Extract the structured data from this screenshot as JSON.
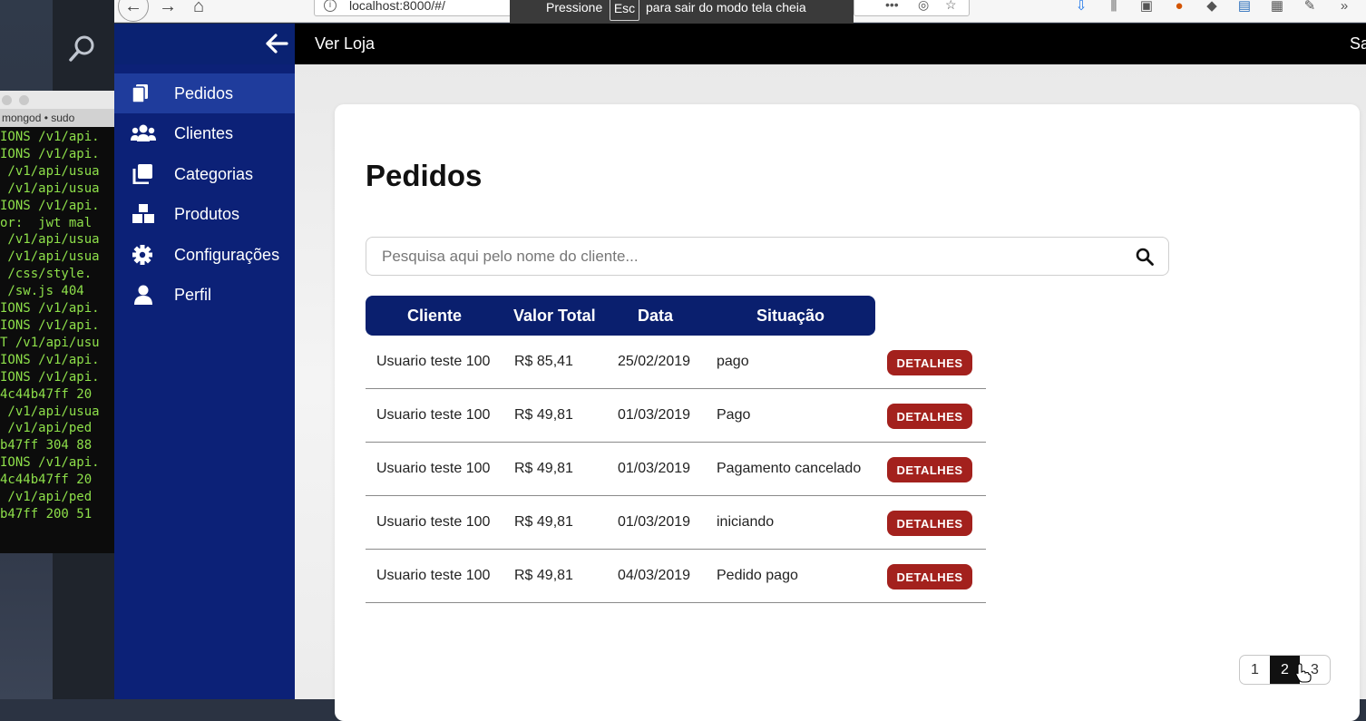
{
  "browser": {
    "url": "localhost:8000/#/",
    "fullscreen_banner": {
      "before": "Pressione",
      "key": "Esc",
      "after": "para sair do modo tela cheia"
    }
  },
  "terminal": {
    "tab_title": "mongod • sudo",
    "lines": [
      "IONS /v1/api.",
      "IONS /v1/api.",
      " /v1/api/usua",
      " /v1/api/usua",
      "IONS /v1/api.",
      "or:  jwt mal",
      " /v1/api/usua",
      " /v1/api/usua",
      " /css/style.",
      " /sw.js 404 ",
      "IONS /v1/api.",
      "IONS /v1/api.",
      "T /v1/api/usu",
      "IONS /v1/api.",
      "IONS /v1/api.",
      "4c44b47ff 20",
      " /v1/api/usua",
      " /v1/api/ped",
      "b47ff 304 88",
      "IONS /v1/api.",
      "4c44b47ff 20",
      " /v1/api/ped",
      "b47ff 200 51"
    ]
  },
  "header": {
    "title": "Ver Loja",
    "right_text": "Sa"
  },
  "sidebar": {
    "items": [
      {
        "label": "Pedidos",
        "icon": "copy-icon",
        "active": true
      },
      {
        "label": "Clientes",
        "icon": "users-icon",
        "active": false
      },
      {
        "label": "Categorias",
        "icon": "clone-icon",
        "active": false
      },
      {
        "label": "Produtos",
        "icon": "boxes-icon",
        "active": false
      },
      {
        "label": "Configurações",
        "icon": "gear-icon",
        "active": false
      },
      {
        "label": "Perfil",
        "icon": "user-icon",
        "active": false
      }
    ]
  },
  "main": {
    "title": "Pedidos",
    "search": {
      "placeholder": "Pesquisa aqui pelo nome do cliente...",
      "value": ""
    },
    "table": {
      "headers": [
        "Cliente",
        "Valor Total",
        "Data",
        "Situação"
      ],
      "action_label": "DETALHES",
      "rows": [
        {
          "cliente": "Usuario teste 100",
          "valor": "R$ 85,41",
          "data": "25/02/2019",
          "situacao": "pago"
        },
        {
          "cliente": "Usuario teste 100",
          "valor": "R$ 49,81",
          "data": "01/03/2019",
          "situacao": "Pago"
        },
        {
          "cliente": "Usuario teste 100",
          "valor": "R$ 49,81",
          "data": "01/03/2019",
          "situacao": "Pagamento cancelado"
        },
        {
          "cliente": "Usuario teste 100",
          "valor": "R$ 49,81",
          "data": "01/03/2019",
          "situacao": "iniciando"
        },
        {
          "cliente": "Usuario teste 100",
          "valor": "R$ 49,81",
          "data": "04/03/2019",
          "situacao": "Pedido pago"
        }
      ]
    },
    "pagination": {
      "pages": [
        "1",
        "2",
        "3"
      ],
      "current": "2"
    }
  },
  "colors": {
    "sidebar": "#0c2177",
    "sidebar_active": "#1f3c9c",
    "table_header": "#0a1f6e",
    "action_button": "#a3211d",
    "header": "#000000"
  }
}
